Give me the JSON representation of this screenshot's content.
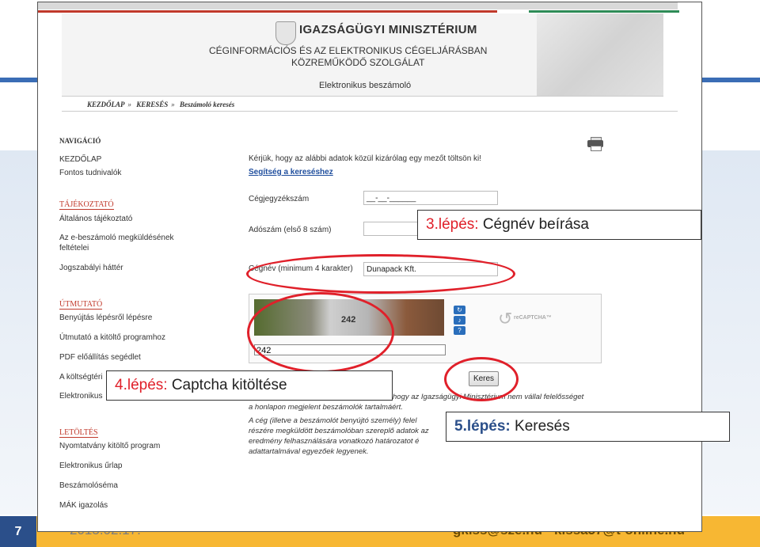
{
  "slide": {
    "page_number": "7",
    "date": "2015.02.17.",
    "email": "gkiss@sze.hu - kissa57@t-online.hu"
  },
  "site": {
    "ministry": "IGAZSÁGÜGYI MINISZTÉRIUM",
    "service_line1": "CÉGINFORMÁCIÓS ÉS AZ ELEKTRONIKUS CÉGELJÁRÁSBAN",
    "service_line2": "KÖZREMŰKÖDŐ SZOLGÁLAT",
    "subtitle": "Elektronikus beszámoló"
  },
  "breadcrumb": [
    "KEZDŐLAP",
    "KERESÉS",
    "Beszámoló keresés"
  ],
  "nav": {
    "header": "NAVIGÁCIÓ",
    "items": [
      {
        "label": "KEZDŐLAP"
      },
      {
        "label": "Fontos tudnivalók"
      }
    ],
    "sections": [
      {
        "title": "TÁJÉKOZTATÓ",
        "items": [
          "Általános tájékoztató",
          "Az e-beszámoló megküldésének",
          "feltételei",
          "Jogszabályi háttér"
        ]
      },
      {
        "title": "ÚTMUTATÓ",
        "items": [
          "Benyújtás lépésről lépésre",
          "Útmutató a kitöltő programhoz",
          "PDF előállítás segédlet",
          "A költségtéri",
          "Elektronikus"
        ]
      },
      {
        "title": "LETÖLTÉS",
        "items": [
          "Nyomtatvány kitöltő program",
          "Elektronikus űrlap",
          "Beszámolóséma",
          "MÁK igazolás"
        ]
      }
    ]
  },
  "form": {
    "instruction": "Kérjük, hogy az alábbi adatok közül kizárólag egy mezőt töltsön ki!",
    "help_link": "Segítség a kereséshez",
    "cegjegyzekszam_label": "Cégjegyzékszám",
    "cegjegyzekszam_value": "__-__-______",
    "adoszam_label": "Adószám (első 8 szám)",
    "adoszam_value": "",
    "cegnev_label": "Cégnév (minimum 4 karakter)",
    "cegnev_value": "Dunapack Kft.",
    "captcha_image_text": "242",
    "captcha_value": "242",
    "recaptcha_label": "reCAPTCHA™",
    "search_button": "Keres"
  },
  "disclaimer": {
    "line1": "hogy az Igazságügyi Minisztérium nem vállal felelősséget",
    "line2": "a honlapon megjelent beszámolók tartalmáért.",
    "line3": "A cég (illetve a beszámolót benyújtó személy) felel",
    "line4": "részére megküldött beszámolóban szereplő adatok az",
    "line5": "eredmény felhasználására vonatkozó határozatot é",
    "line6": "adattartalmával egyezőek legyenek."
  },
  "callouts": [
    {
      "step": "3.lépés:",
      "text": "Cégnév beírása"
    },
    {
      "step": "4.lépés:",
      "text": "Captcha kitöltése"
    },
    {
      "step": "5.lépés:",
      "text": "Keresés"
    }
  ],
  "colors": {
    "annotation_red": "#e0202a",
    "step_blue": "#2b4f8a",
    "link_blue": "#1f4e9d",
    "footer_orange": "#f7b733"
  }
}
